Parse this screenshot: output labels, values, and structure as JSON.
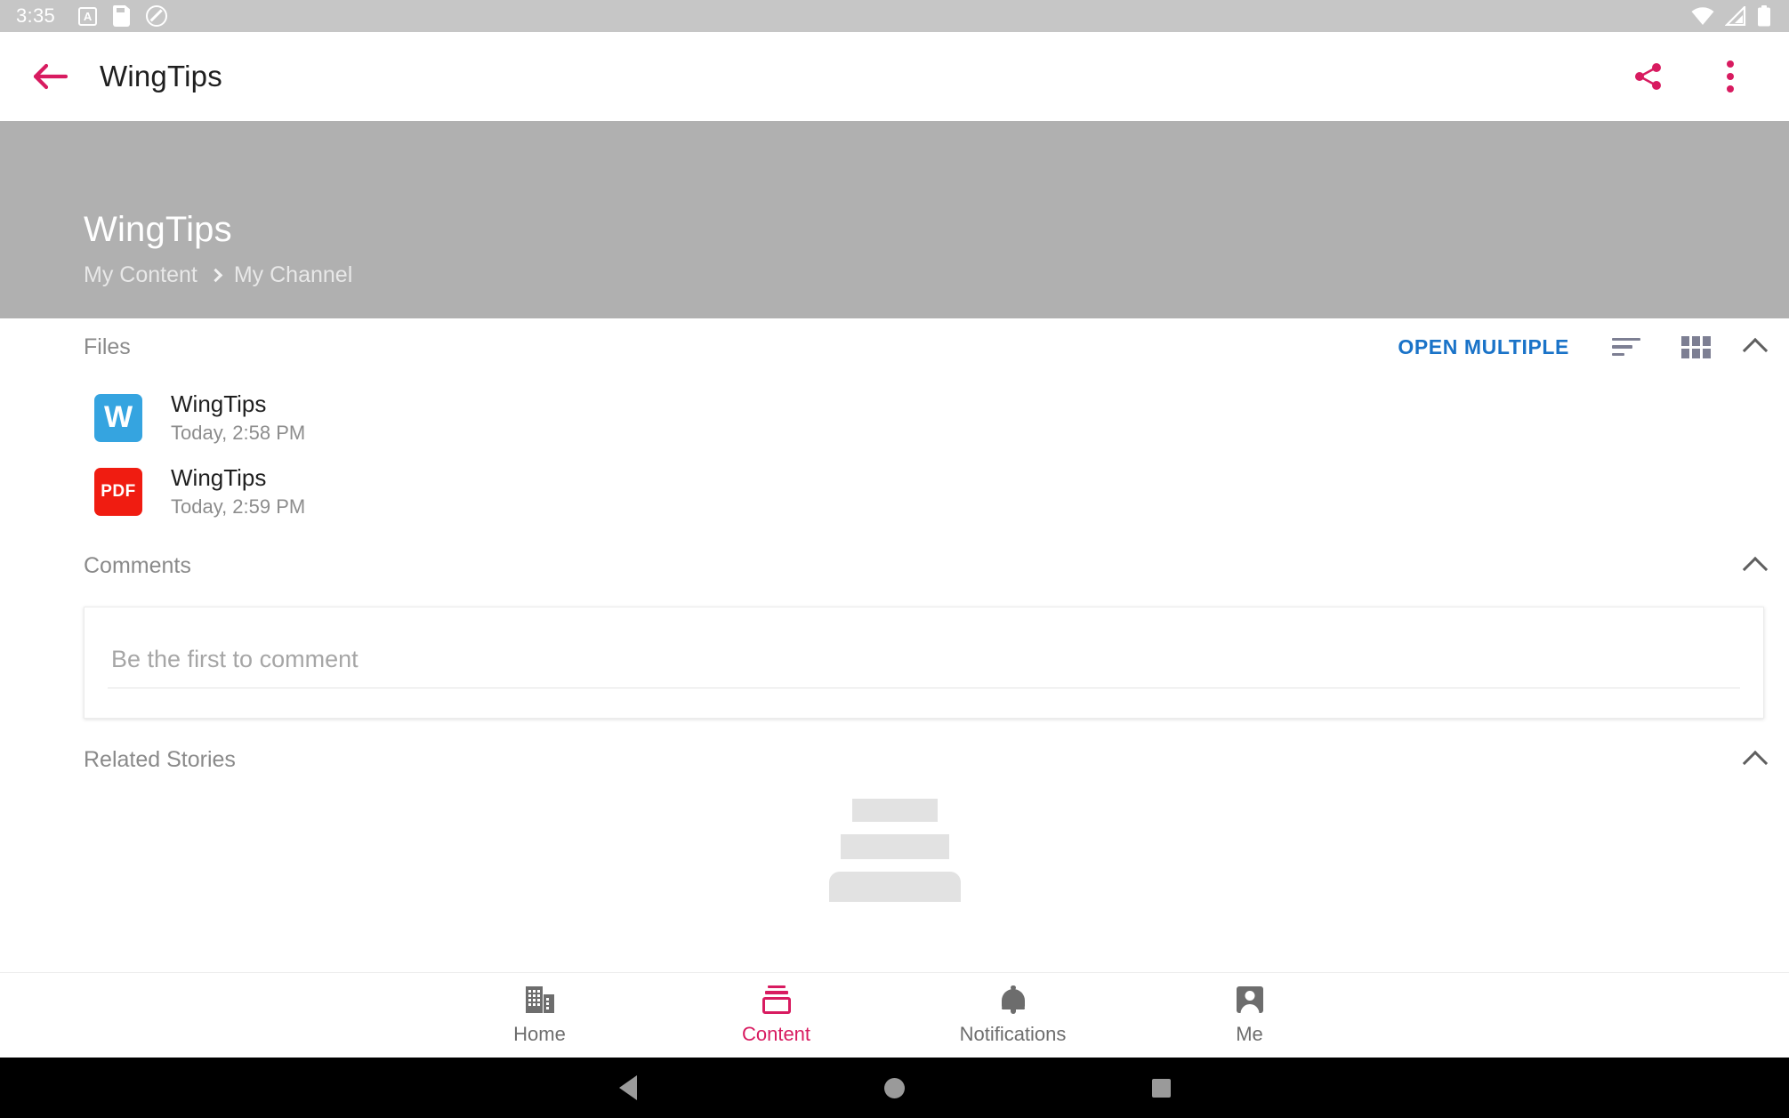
{
  "statusbar": {
    "clock": "3:35",
    "icons_left": [
      "alarm-a-icon",
      "sdcard-icon",
      "do-not-disturb-icon"
    ],
    "icons_right": [
      "wifi-icon",
      "cellular-signal-icon",
      "battery-icon"
    ]
  },
  "appbar": {
    "title": "WingTips",
    "back_icon": "back-arrow-icon",
    "share_icon": "share-icon",
    "overflow_icon": "more-vertical-icon",
    "accent": "#d81b60"
  },
  "hero": {
    "title": "WingTips",
    "breadcrumb": {
      "parent": "My Content",
      "separator": "chevron-right-icon",
      "current": "My Channel"
    },
    "background": "#b0b0b0"
  },
  "files_section": {
    "title": "Files",
    "open_multiple_label": "OPEN MULTIPLE",
    "open_multiple_color": "#1a73c8",
    "sort_icon": "sort-icon",
    "grid_icon": "grid-view-icon",
    "collapse_icon": "chevron-up-icon",
    "items": [
      {
        "kind": "word",
        "badge": "W",
        "name": "WingTips",
        "date": "Today, 2:58 PM",
        "color": "#35a4e0"
      },
      {
        "kind": "pdf",
        "badge": "PDF",
        "name": "WingTips",
        "date": "Today, 2:59 PM",
        "color": "#f01c11"
      }
    ]
  },
  "comments_section": {
    "title": "Comments",
    "collapse_icon": "chevron-up-icon",
    "input_placeholder": "Be the first to comment",
    "input_value": ""
  },
  "related_section": {
    "title": "Related Stories",
    "collapse_icon": "chevron-up-icon",
    "loading_placeholder": "skeleton-loading"
  },
  "bottomnav": {
    "active": "Content",
    "active_color": "#d81b60",
    "items": [
      {
        "label": "Home",
        "icon": "building-icon"
      },
      {
        "label": "Content",
        "icon": "content-layers-icon"
      },
      {
        "label": "Notifications",
        "icon": "bell-icon"
      },
      {
        "label": "Me",
        "icon": "person-icon"
      }
    ]
  },
  "system_navbar": {
    "back": "android-back-icon",
    "home": "android-home-icon",
    "recents": "android-recents-icon"
  }
}
